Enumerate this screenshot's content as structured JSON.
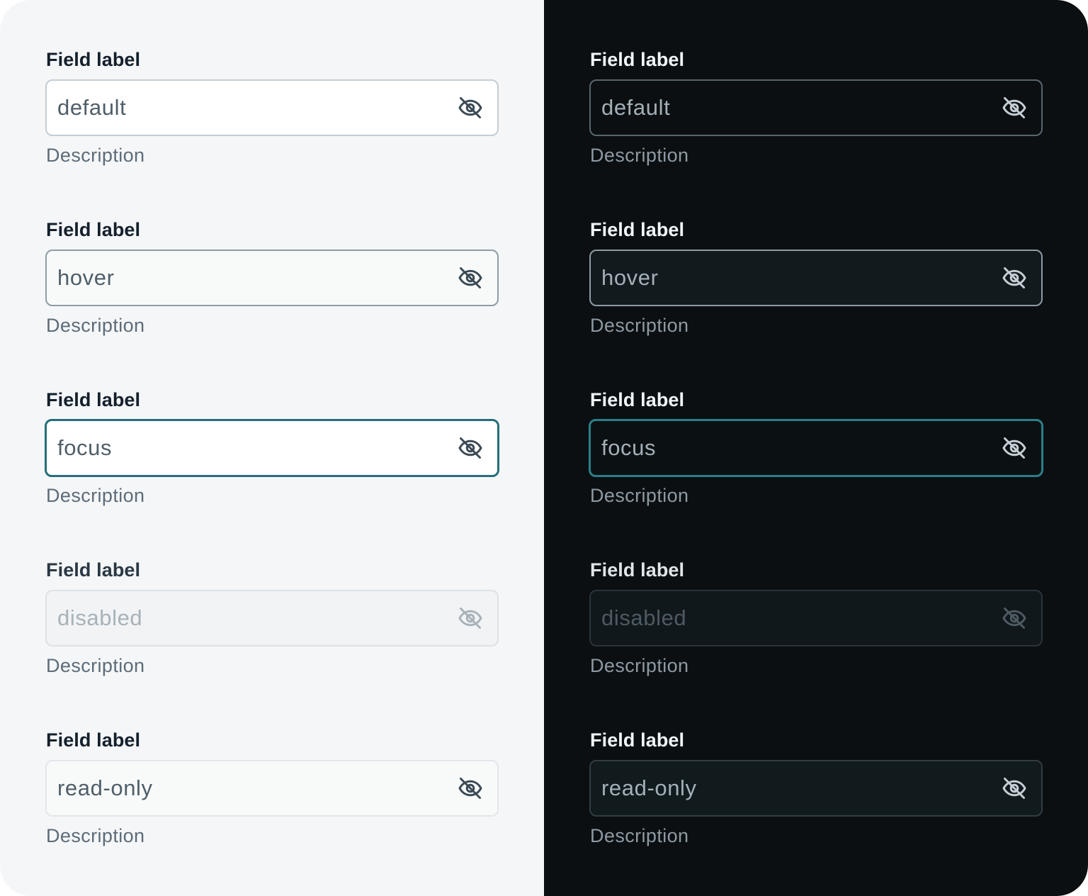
{
  "colors": {
    "light_background": "#f4f6f8",
    "dark_background": "#0b0f12",
    "focus_accent_light": "#246f78",
    "focus_accent_dark": "#2a8088"
  },
  "icon": "eye-off-icon",
  "light": {
    "fields": [
      {
        "state": "default",
        "label": "Field label",
        "value": "default",
        "description": "Description"
      },
      {
        "state": "hover",
        "label": "Field label",
        "value": "hover",
        "description": "Description"
      },
      {
        "state": "focus",
        "label": "Field label",
        "value": "focus",
        "description": "Description"
      },
      {
        "state": "disabled",
        "label": "Field label",
        "value": "disabled",
        "description": "Description"
      },
      {
        "state": "read-only",
        "label": "Field label",
        "value": "read-only",
        "description": "Description"
      }
    ]
  },
  "dark": {
    "fields": [
      {
        "state": "default",
        "label": "Field label",
        "value": "default",
        "description": "Description"
      },
      {
        "state": "hover",
        "label": "Field label",
        "value": "hover",
        "description": "Description"
      },
      {
        "state": "focus",
        "label": "Field label",
        "value": "focus",
        "description": "Description"
      },
      {
        "state": "disabled",
        "label": "Field label",
        "value": "disabled",
        "description": "Description"
      },
      {
        "state": "read-only",
        "label": "Field label",
        "value": "read-only",
        "description": "Description"
      }
    ]
  }
}
